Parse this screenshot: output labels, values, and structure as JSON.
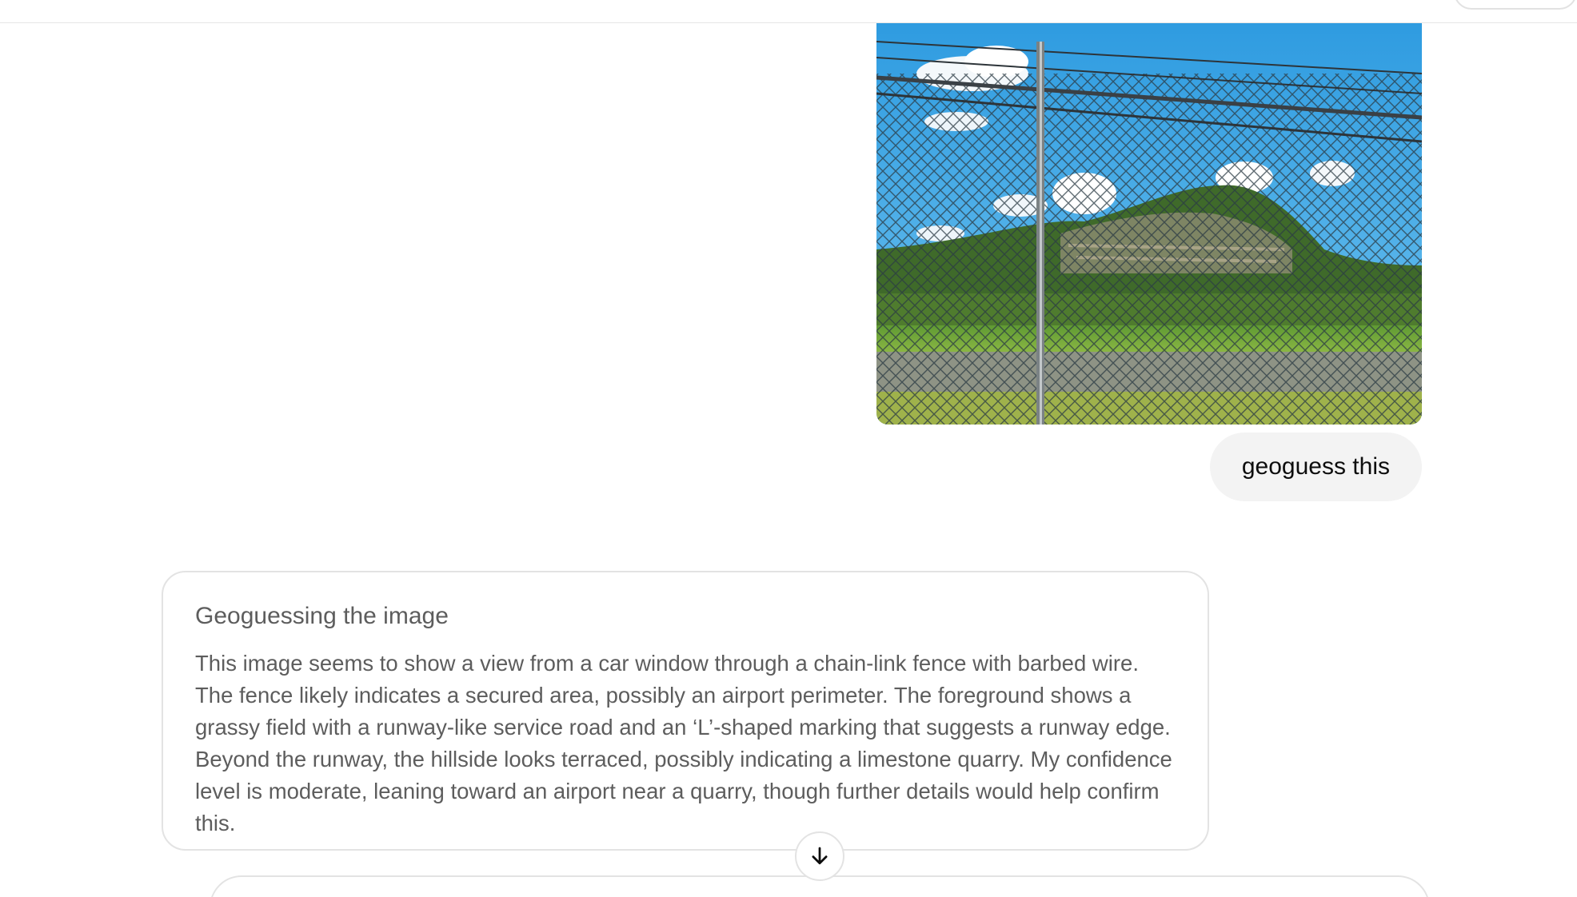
{
  "conversation": {
    "user_message": {
      "image_icon": "photo-attachment",
      "text": "geoguess this"
    },
    "reasoning": {
      "title": "Geoguessing the image",
      "body": "This image seems to show a view from a car window through a chain-link fence with barbed wire. The fence likely indicates a secured area, possibly an airport perimeter. The foreground shows a grassy field with a runway-like service road and an ‘L’-shaped marking that suggests a runway edge. Beyond the runway, the hillside looks terraced, possibly indicating a limestone quarry. My confidence level is moderate, leaning toward an airport near a quarry, though further details would help confirm this."
    }
  },
  "controls": {
    "scroll_down_icon": "arrow-down-icon"
  },
  "colors": {
    "bubble_bg": "#f3f3f3",
    "muted_text": "#5d5d5d",
    "border": "#e3e3e3"
  }
}
